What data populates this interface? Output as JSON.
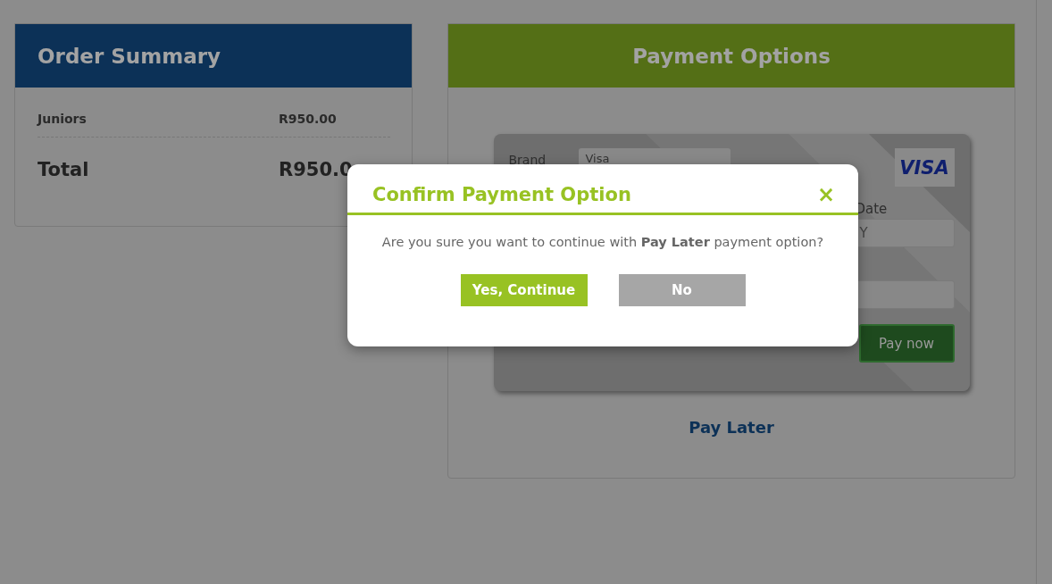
{
  "order_summary": {
    "title": "Order Summary",
    "items": [
      {
        "name": "Juniors",
        "price": "R950.00"
      }
    ],
    "total_label": "Total",
    "total_value": "R950.0"
  },
  "payment_options": {
    "title": "Payment Options",
    "card_form": {
      "brand_label": "Brand",
      "brand_value": "Visa",
      "card_logo": "VISA",
      "expiry_label": "Date",
      "expiry_value": "Y",
      "pay_button": "Pay now"
    },
    "pay_later_link": "Pay Later"
  },
  "dialog": {
    "title": "Confirm Payment Option",
    "close": "×",
    "message": "Are you sure you want to continue with **Pay Later** payment option?",
    "buttons": [
      {
        "label": "Yes, Continue",
        "kind": "primary"
      },
      {
        "label": "No",
        "kind": "secondary"
      }
    ]
  }
}
